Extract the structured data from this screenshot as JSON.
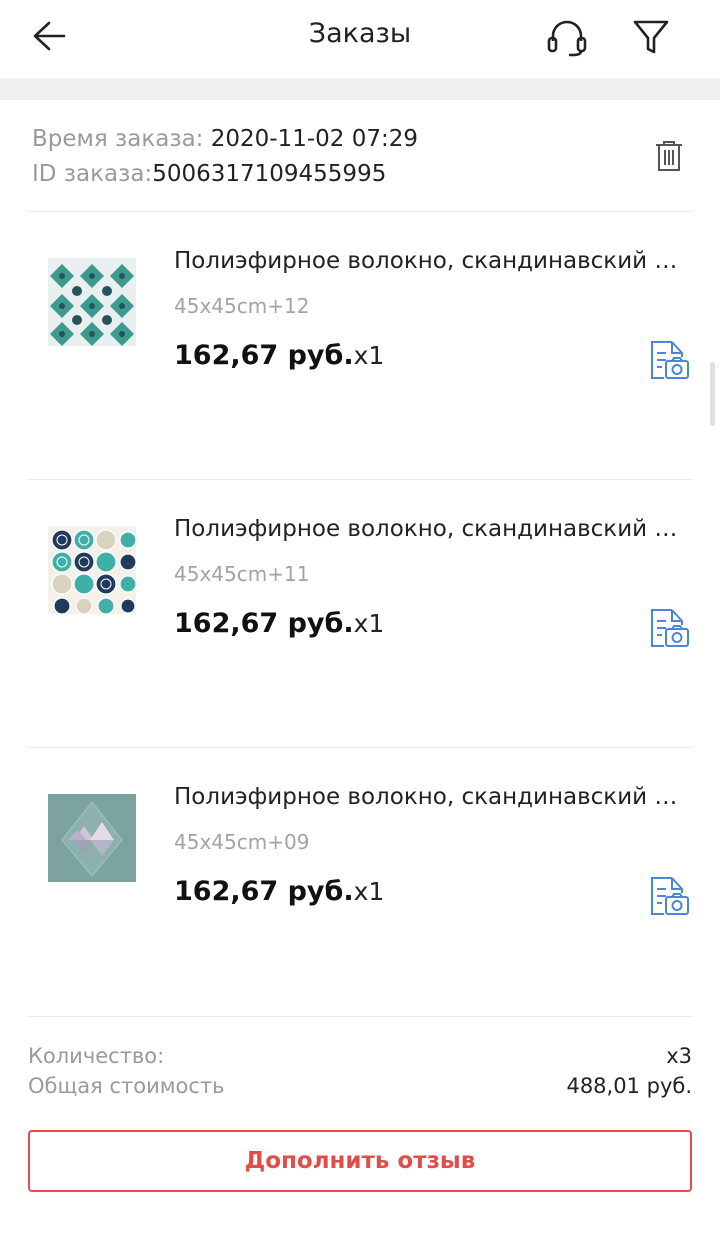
{
  "header": {
    "title": "Заказы",
    "back_icon": "arrow-left-icon",
    "support_icon": "headset-icon",
    "filter_icon": "filter-icon"
  },
  "order": {
    "time_label": "Время заказа: ",
    "time_value": "2020-11-02 07:29",
    "id_label": "ID заказа:",
    "id_value": "5006317109455995",
    "delete_icon": "trash-icon"
  },
  "items": [
    {
      "title": "Полиэфирное волокно, скандинавский к...",
      "variant": "45x45cm+12",
      "price": "162,67 руб.",
      "qty": "x1",
      "thumb_colors": [
        "#3d9a8e",
        "#24545c"
      ]
    },
    {
      "title": "Полиэфирное волокно, скандинавский к...",
      "variant": "45x45cm+11",
      "price": "162,67 руб.",
      "qty": "x1",
      "thumb_colors": [
        "#1f3a5a",
        "#3fb0a8",
        "#d9d2bf"
      ]
    },
    {
      "title": "Полиэфирное волокно, скандинавский к...",
      "variant": "45x45cm+09",
      "price": "162,67 руб.",
      "qty": "x1",
      "thumb_colors": [
        "#7aa3a1",
        "#cfc4d8"
      ]
    }
  ],
  "summary": {
    "quantity_label": "Количество:",
    "quantity_value": "x3",
    "total_label": "Общая стоимость",
    "total_value": "488,01 руб."
  },
  "actions": {
    "add_review_label": "Дополнить отзыв"
  },
  "colors": {
    "accent": "#e04d4d",
    "icon_blue": "#4a86d8",
    "muted_text": "#9a9a9a"
  }
}
